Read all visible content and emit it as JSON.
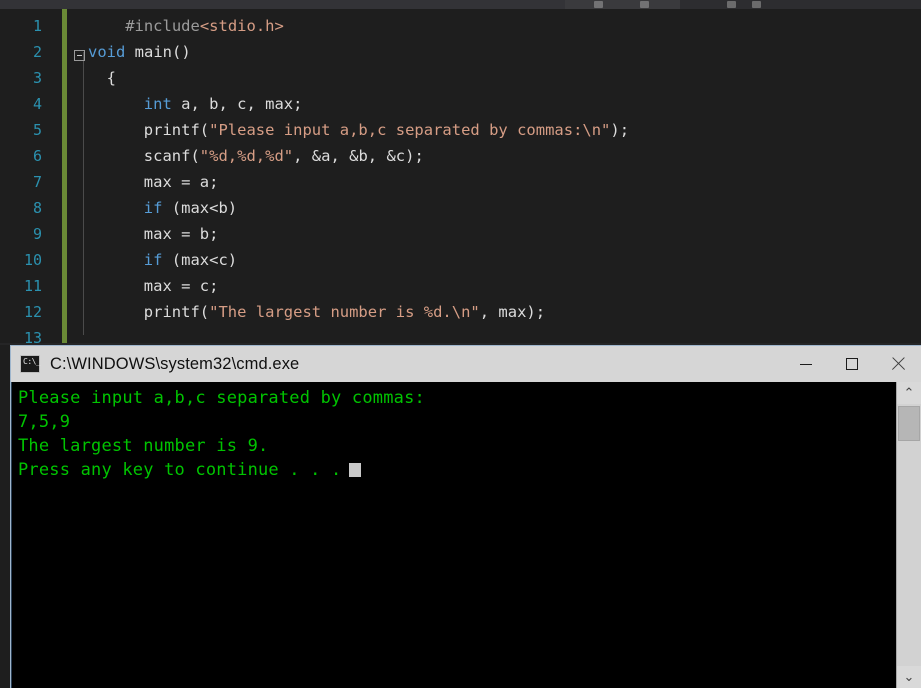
{
  "editor": {
    "lines": [
      {
        "n": "1",
        "tokens": [
          {
            "t": "#include",
            "c": "preproc"
          },
          {
            "t": "<stdio.h>",
            "c": "string"
          }
        ],
        "indent": 4
      },
      {
        "n": "2",
        "tokens": [
          {
            "t": "void",
            "c": "keyword"
          },
          {
            "t": " main()",
            "c": "plain"
          }
        ],
        "indent": 0
      },
      {
        "n": "3",
        "tokens": [
          {
            "t": "{",
            "c": "plain"
          }
        ],
        "indent": 2
      },
      {
        "n": "4",
        "tokens": [
          {
            "t": "int",
            "c": "keyword"
          },
          {
            "t": " a, b, c, max;",
            "c": "plain"
          }
        ],
        "indent": 6
      },
      {
        "n": "5",
        "tokens": [
          {
            "t": "printf(",
            "c": "plain"
          },
          {
            "t": "\"Please input a,b,c separated by commas:\\n\"",
            "c": "string"
          },
          {
            "t": ");",
            "c": "plain"
          }
        ],
        "indent": 6
      },
      {
        "n": "6",
        "tokens": [
          {
            "t": "scanf(",
            "c": "plain"
          },
          {
            "t": "\"%d,%d,%d\"",
            "c": "string"
          },
          {
            "t": ", &a, &b, &c);",
            "c": "plain"
          }
        ],
        "indent": 6
      },
      {
        "n": "7",
        "tokens": [
          {
            "t": "max = a;",
            "c": "plain"
          }
        ],
        "indent": 6
      },
      {
        "n": "8",
        "tokens": [
          {
            "t": "if",
            "c": "keyword"
          },
          {
            "t": " (max<b)",
            "c": "plain"
          }
        ],
        "indent": 6
      },
      {
        "n": "9",
        "tokens": [
          {
            "t": "max = b;",
            "c": "plain"
          }
        ],
        "indent": 6
      },
      {
        "n": "10",
        "tokens": [
          {
            "t": "if",
            "c": "keyword"
          },
          {
            "t": " (max<c)",
            "c": "plain"
          }
        ],
        "indent": 6
      },
      {
        "n": "11",
        "tokens": [
          {
            "t": "max = c;",
            "c": "plain"
          }
        ],
        "indent": 6
      },
      {
        "n": "12",
        "tokens": [
          {
            "t": "printf(",
            "c": "plain"
          },
          {
            "t": "\"The largest number is %d.\\n\"",
            "c": "string"
          },
          {
            "t": ", max);",
            "c": "plain"
          }
        ],
        "indent": 6
      },
      {
        "n": "13",
        "tokens": [
          {
            "t": "",
            "c": "plain"
          }
        ],
        "indent": 0
      }
    ],
    "fold_marker": "collapse-minus",
    "colors": {
      "background": "#1e1e1e",
      "line_number": "#2b91af",
      "keyword": "#569cd6",
      "string": "#d69d85",
      "plain_text": "#dcdcdc",
      "preprocessor": "#9b9b9b",
      "change_bar": "#6a8a36"
    }
  },
  "cmd_window": {
    "title": "C:\\WINDOWS\\system32\\cmd.exe",
    "icon": "cmd-console-icon",
    "buttons": {
      "minimize": "Minimize",
      "maximize": "Maximize",
      "close": "Close"
    },
    "console": {
      "lines": [
        "Please input a,b,c separated by commas:",
        "7,5,9",
        "The largest number is 9.",
        "Press any key to continue . . ."
      ],
      "text_color": "#00c400",
      "background": "#000000",
      "cursor": "block-cursor"
    },
    "scrollbar": {
      "up_arrow": "⌃",
      "down_arrow": "⌄"
    }
  }
}
